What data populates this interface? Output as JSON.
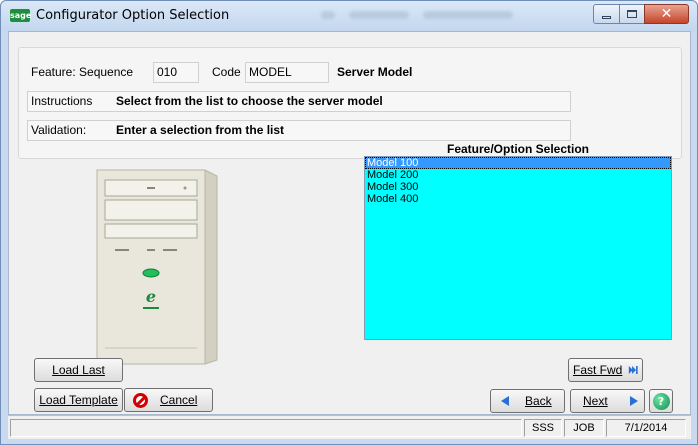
{
  "window": {
    "title": "Configurator Option Selection",
    "logo_text": "sage"
  },
  "header": {
    "feature_sequence_label": "Feature: Sequence",
    "sequence_value": "010",
    "code_label": "Code",
    "code_value": "MODEL",
    "feature_name": "Server Model",
    "instructions_label": "Instructions",
    "instructions_value": "Select from the list to choose the server model",
    "validation_label": "Validation:",
    "validation_value": "Enter a selection from the list"
  },
  "selection": {
    "title": "Feature/Option Selection",
    "options": [
      "Model 100",
      "Model 200",
      "Model 300",
      "Model 400"
    ],
    "selected": "Model 100"
  },
  "buttons": {
    "load_last": "Load Last",
    "load_template": "Load Template",
    "cancel": "Cancel",
    "fast_fwd": "Fast Fwd",
    "back": "Back",
    "next": "Next"
  },
  "status": {
    "company": "SSS",
    "module": "JOB",
    "date": "7/1/2014"
  },
  "colors": {
    "list_background": "#00ffff",
    "selected_item": "#3399ff",
    "window_frame": "#c9daf0"
  },
  "icons": [
    "sage-logo-icon",
    "minimize-icon",
    "maximize-icon",
    "close-icon",
    "cancel-icon",
    "fast-forward-icon",
    "back-arrow-icon",
    "next-arrow-icon",
    "help-icon"
  ]
}
